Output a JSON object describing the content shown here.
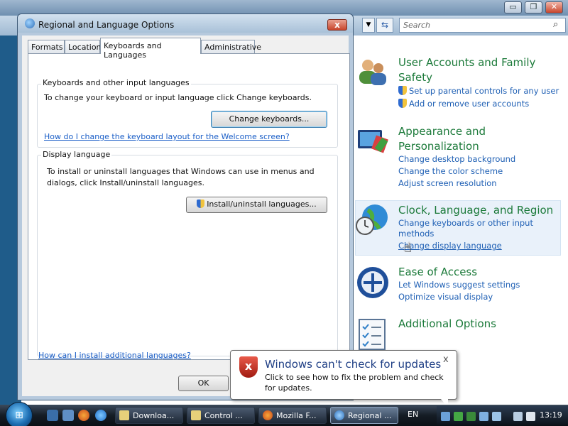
{
  "control_panel": {
    "search_placeholder": "Search",
    "window_buttons": [
      "▭",
      "❐",
      "✕"
    ],
    "categories": [
      {
        "title": "User Accounts and Family Safety",
        "title_lines": [
          "User Accounts and Family",
          "Safety"
        ],
        "links": [
          "Set up parental controls for any user",
          "Add or remove user accounts"
        ]
      },
      {
        "title_lines": [
          "Appearance and",
          "Personalization"
        ],
        "links": [
          "Change desktop background",
          "Change the color scheme",
          "Adjust screen resolution"
        ]
      },
      {
        "title_lines": [
          "Clock, Language, and Region"
        ],
        "links": [
          "Change keyboards or other input",
          "methods",
          "Change display language"
        ]
      },
      {
        "title_lines": [
          "Ease of Access"
        ],
        "links": [
          "Let Windows suggest settings",
          "Optimize visual display"
        ]
      },
      {
        "title_lines": [
          "Additional Options"
        ],
        "links": []
      }
    ]
  },
  "dialog": {
    "title": "Regional and Language Options",
    "close": "x",
    "tabs": [
      "Formats",
      "Location",
      "Keyboards and Languages",
      "Administrative"
    ],
    "active_tab": "Keyboards and Languages",
    "keyboards_group": {
      "label": "Keyboards and other input languages",
      "text": "To change your keyboard or input language click Change keyboards.",
      "button": "Change keyboards...",
      "link": "How do I change the keyboard layout for the Welcome screen?"
    },
    "display_group": {
      "label": "Display language",
      "text_line1": "To install or uninstall languages that Windows can use in menus and",
      "text_line2": "dialogs, click Install/uninstall languages.",
      "button": "Install/uninstall languages..."
    },
    "bottom_link": "How can I install additional languages?",
    "ok": "OK"
  },
  "balloon": {
    "title": "Windows can't check for updates",
    "text": "Click to see how to fix the problem and check for updates.",
    "close": "x",
    "icon": "x"
  },
  "taskbar": {
    "tasks": [
      "Downloa...",
      "Control ...",
      "Mozilla F...",
      "Regional ..."
    ],
    "language": "EN",
    "clock": "13:19",
    "colors": {
      "accent": "#1e5fb4",
      "category_title": "#1c7a3a"
    }
  }
}
